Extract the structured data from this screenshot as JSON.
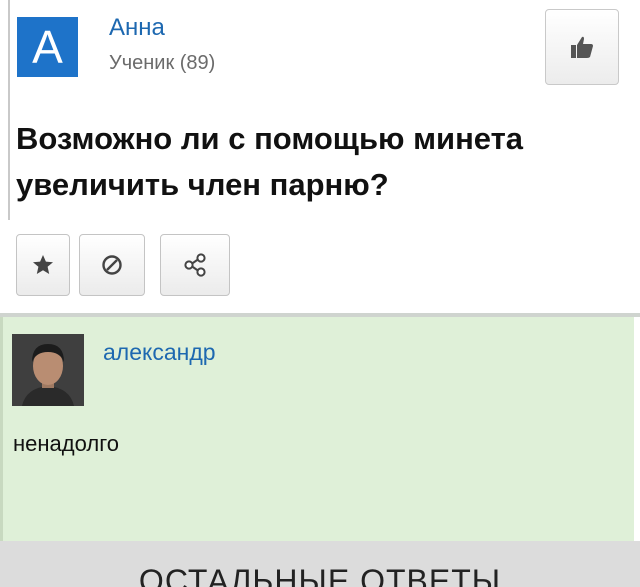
{
  "question": {
    "author": {
      "avatar_letter": "А",
      "name": "Анна",
      "rank": "Ученик (89)"
    },
    "title": "Возможно ли с помощью минета увеличить член парню?",
    "icons": {
      "like": "thumbs-up-icon",
      "favorite": "star-icon",
      "block": "block-icon",
      "share": "share-icon"
    }
  },
  "answer": {
    "author_name": "александр",
    "text": "ненадолго",
    "avatar": "user-photo"
  },
  "footer": {
    "label": "ОСТАЛЬНЫЕ ОТВЕТЫ"
  },
  "colors": {
    "accent": "#1d68b0",
    "avatar_bg": "#1e73c9",
    "answer_bg": "#dff0d8"
  }
}
